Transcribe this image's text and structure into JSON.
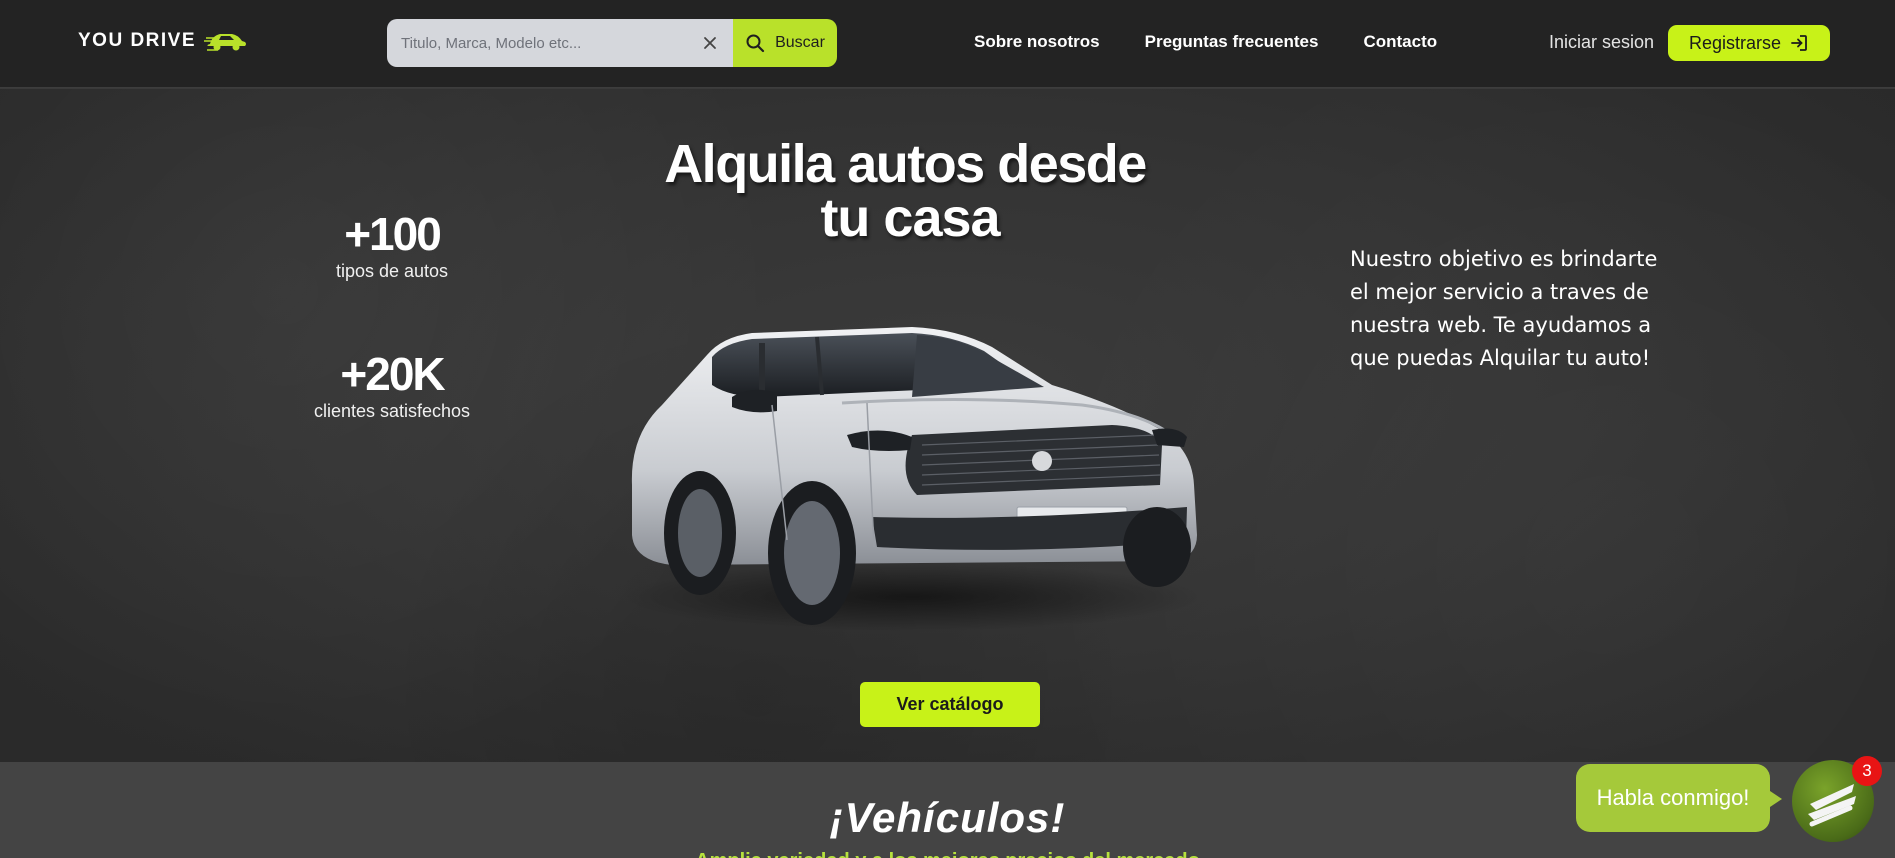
{
  "header": {
    "logo_text": "YOU DRIVE",
    "logo_icon": "car-icon",
    "search": {
      "placeholder": "Titulo, Marca, Modelo etc...",
      "value": "",
      "button_label": "Buscar",
      "clear_icon": "close-icon",
      "search_icon": "search-icon"
    },
    "nav": [
      {
        "label": "Sobre nosotros"
      },
      {
        "label": "Preguntas frecuentes"
      },
      {
        "label": "Contacto"
      }
    ],
    "login_label": "Iniciar sesion",
    "register_label": "Registrarse",
    "register_icon": "sign-in-icon"
  },
  "hero": {
    "title_line1": "Alquila autos desde",
    "title_line2": "tu casa",
    "stats": [
      {
        "value": "+100",
        "label": "tipos de autos"
      },
      {
        "value": "+20K",
        "label": "clientes satisfechos"
      }
    ],
    "description": "Nuestro objetivo es brindarte el mejor servicio a traves de nuestra web. Te ayudamos a que puedas Alquilar tu auto!",
    "catalog_button": "Ver catálogo"
  },
  "vehicles_section": {
    "title": "¡Vehículos!",
    "subtitle": "Amplia variedad y a los mejores precios del mercado"
  },
  "chat": {
    "bubble_label": "Habla conmigo!",
    "badge_count": "3"
  },
  "colors": {
    "accent": "#c8f218",
    "header_bg": "#232323",
    "hero_bg": "#333333",
    "badge": "#e81414"
  }
}
